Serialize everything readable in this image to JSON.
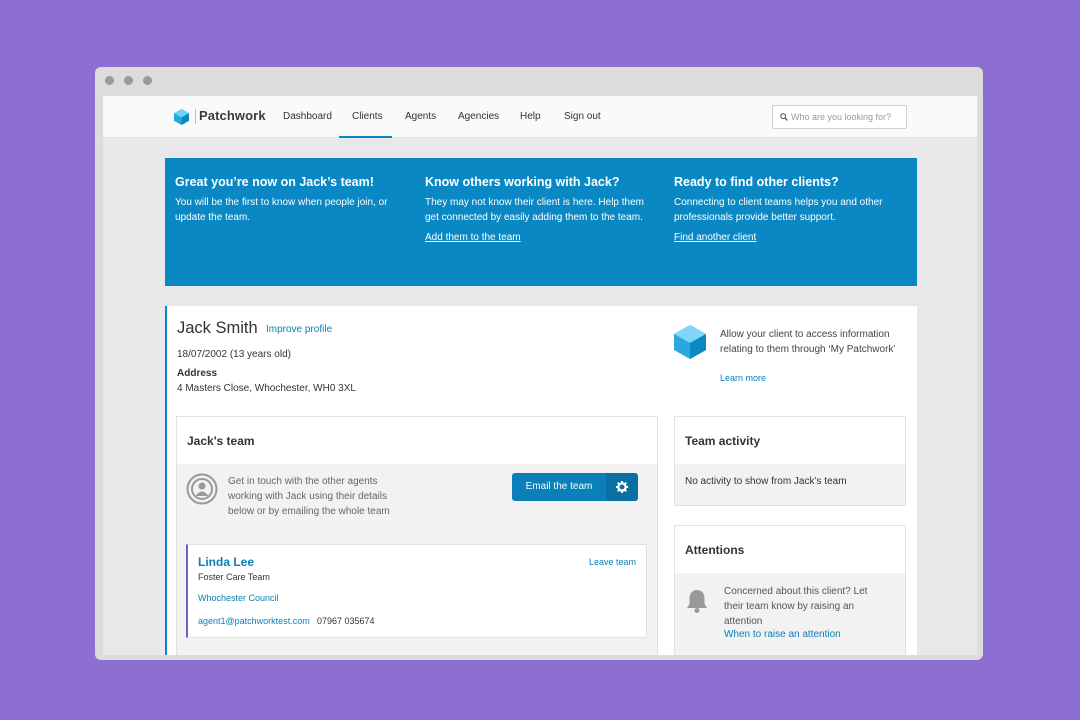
{
  "nav": {
    "brand": "Patchwork",
    "items": [
      {
        "label": "Dashboard",
        "active": false
      },
      {
        "label": "Clients",
        "active": true
      },
      {
        "label": "Agents",
        "active": false
      },
      {
        "label": "Agencies",
        "active": false
      },
      {
        "label": "Help",
        "active": false
      },
      {
        "label": "Sign out",
        "active": false
      }
    ],
    "search_placeholder": "Who are you looking for?"
  },
  "banner": {
    "col1": {
      "title": "Great you’re now on Jack’s team!",
      "text": "You will be the first to know when people join, or update the team."
    },
    "col2": {
      "title": "Know others working with Jack?",
      "text": "They may not know their client is here. Help them get connected by easily adding them to the team.",
      "link": "Add them to the team"
    },
    "col3": {
      "title": "Ready to find other clients?",
      "text": "Connecting to client teams helps you and other professionals provide better support.",
      "link": "Find another client"
    }
  },
  "client": {
    "name": "Jack Smith",
    "improve_link": "Improve profile",
    "dob": "18/07/2002 (13 years old)",
    "address_label": "Address",
    "address": "4 Masters Close, Whochester, WH0 3XL",
    "my_patchwork_text": "Allow your client to access information relating to them through ‘My Patchwork’",
    "learn_more": "Learn more"
  },
  "team": {
    "title": "Jack's team",
    "contact_text": "Get in touch with the other agents working with Jack using their details below or by emailing the whole team",
    "email_button": "Email the team",
    "agent": {
      "name": "Linda Lee",
      "team": "Foster Care Team",
      "leave": "Leave team",
      "agency": "Whochester Council",
      "email": "agent1@patchworktest.com",
      "phone": "07967 035674"
    }
  },
  "activity": {
    "title": "Team activity",
    "empty": "No activity to show from Jack’s team"
  },
  "attentions": {
    "title": "Attentions",
    "text": "Concerned about this client? Let their team know by raising an attention",
    "link": "When to raise an attention"
  },
  "colors": {
    "accent": "#0a88c4",
    "background": "#8c6fd0",
    "agent_border": "#7a5bc7"
  },
  "icons": [
    "logo-icon",
    "search-icon",
    "cube-icon",
    "contact-icon",
    "gear-icon",
    "bell-icon"
  ]
}
